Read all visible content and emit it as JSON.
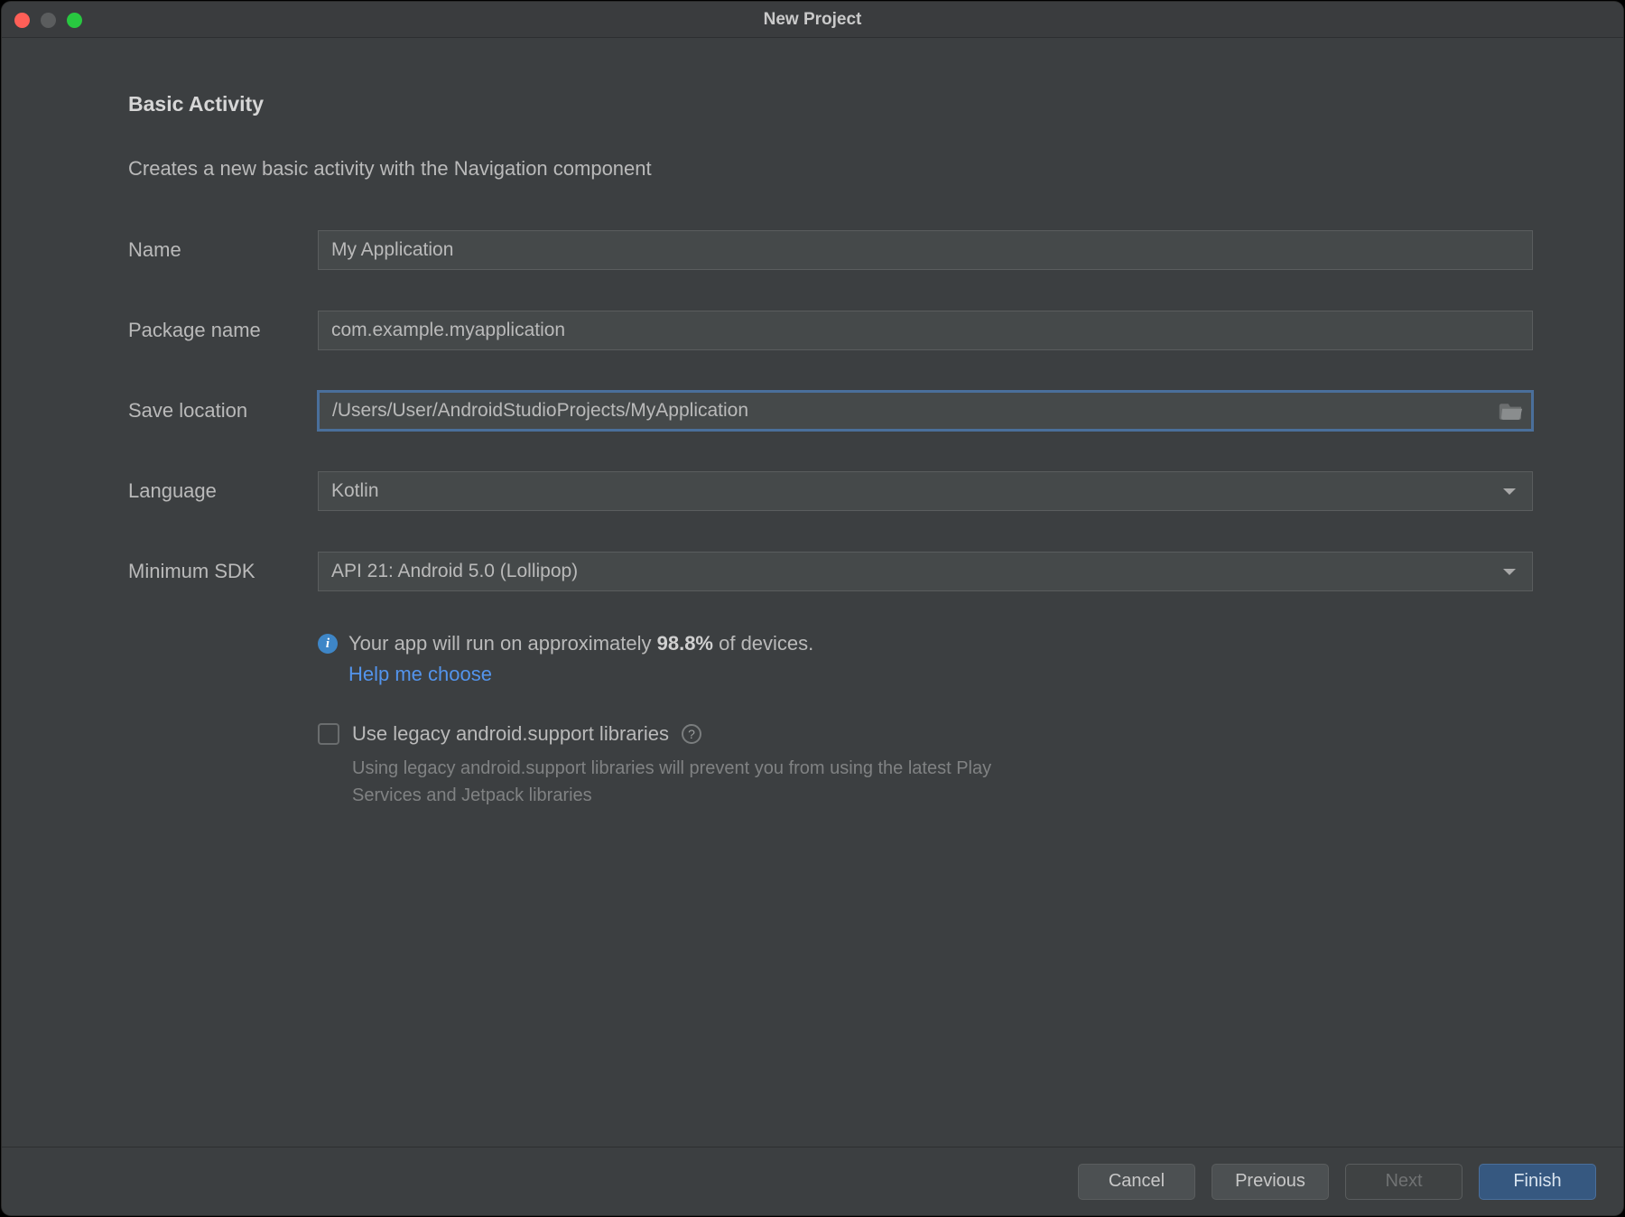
{
  "window": {
    "title": "New Project"
  },
  "header": {
    "heading": "Basic Activity",
    "subheading": "Creates a new basic activity with the Navigation component"
  },
  "form": {
    "name": {
      "label": "Name",
      "value": "My Application"
    },
    "pkg": {
      "label": "Package name",
      "value": "com.example.myapplication"
    },
    "location": {
      "label": "Save location",
      "value": "/Users/User/AndroidStudioProjects/MyApplication"
    },
    "language": {
      "label": "Language",
      "value": "Kotlin"
    },
    "min_sdk": {
      "label": "Minimum SDK",
      "value": "API 21: Android 5.0 (Lollipop)"
    }
  },
  "info": {
    "prefix": "Your app will run on approximately ",
    "percent": "98.8%",
    "suffix": " of devices.",
    "help_link": "Help me choose"
  },
  "legacy": {
    "label": "Use legacy android.support libraries",
    "sub": "Using legacy android.support libraries will prevent you from using the latest Play Services and Jetpack libraries"
  },
  "footer": {
    "cancel": "Cancel",
    "previous": "Previous",
    "next": "Next",
    "finish": "Finish"
  }
}
